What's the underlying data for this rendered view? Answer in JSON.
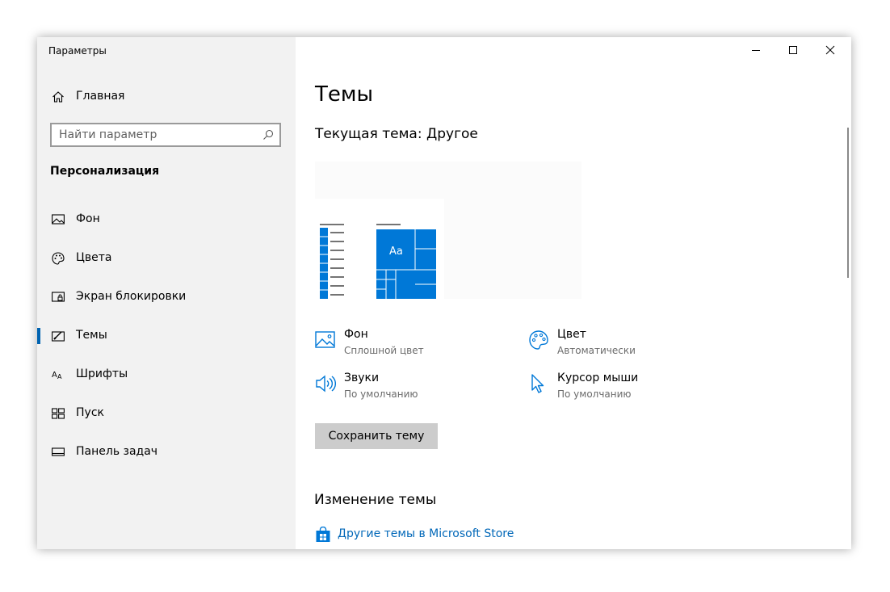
{
  "window": {
    "title": "Параметры"
  },
  "sidebar": {
    "home_label": "Главная",
    "search_placeholder": "Найти параметр",
    "section_title": "Персонализация",
    "items": [
      {
        "label": "Фон",
        "icon": "picture-icon",
        "active": false
      },
      {
        "label": "Цвета",
        "icon": "palette-icon",
        "active": false
      },
      {
        "label": "Экран блокировки",
        "icon": "lock-screen-icon",
        "active": false
      },
      {
        "label": "Темы",
        "icon": "themes-icon",
        "active": true
      },
      {
        "label": "Шрифты",
        "icon": "fonts-icon",
        "active": false
      },
      {
        "label": "Пуск",
        "icon": "start-icon",
        "active": false
      },
      {
        "label": "Панель задач",
        "icon": "taskbar-icon",
        "active": false
      }
    ]
  },
  "main": {
    "page_title": "Темы",
    "current_theme": "Текущая тема: Другое",
    "preview_tile_text": "Aa",
    "properties": [
      {
        "name": "Фон",
        "value": "Сплошной цвет",
        "icon": "picture-icon"
      },
      {
        "name": "Цвет",
        "value": "Автоматически",
        "icon": "palette-icon"
      },
      {
        "name": "Звуки",
        "value": "По умолчанию",
        "icon": "speaker-icon"
      },
      {
        "name": "Курсор мыши",
        "value": "По умолчанию",
        "icon": "cursor-icon"
      }
    ],
    "save_button": "Сохранить тему",
    "change_title": "Изменение темы",
    "store_link": "Другие темы в Microsoft Store"
  },
  "colors": {
    "accent": "#0078d7",
    "link": "#0067b8",
    "sidebar_bg": "#f2f2f2"
  }
}
